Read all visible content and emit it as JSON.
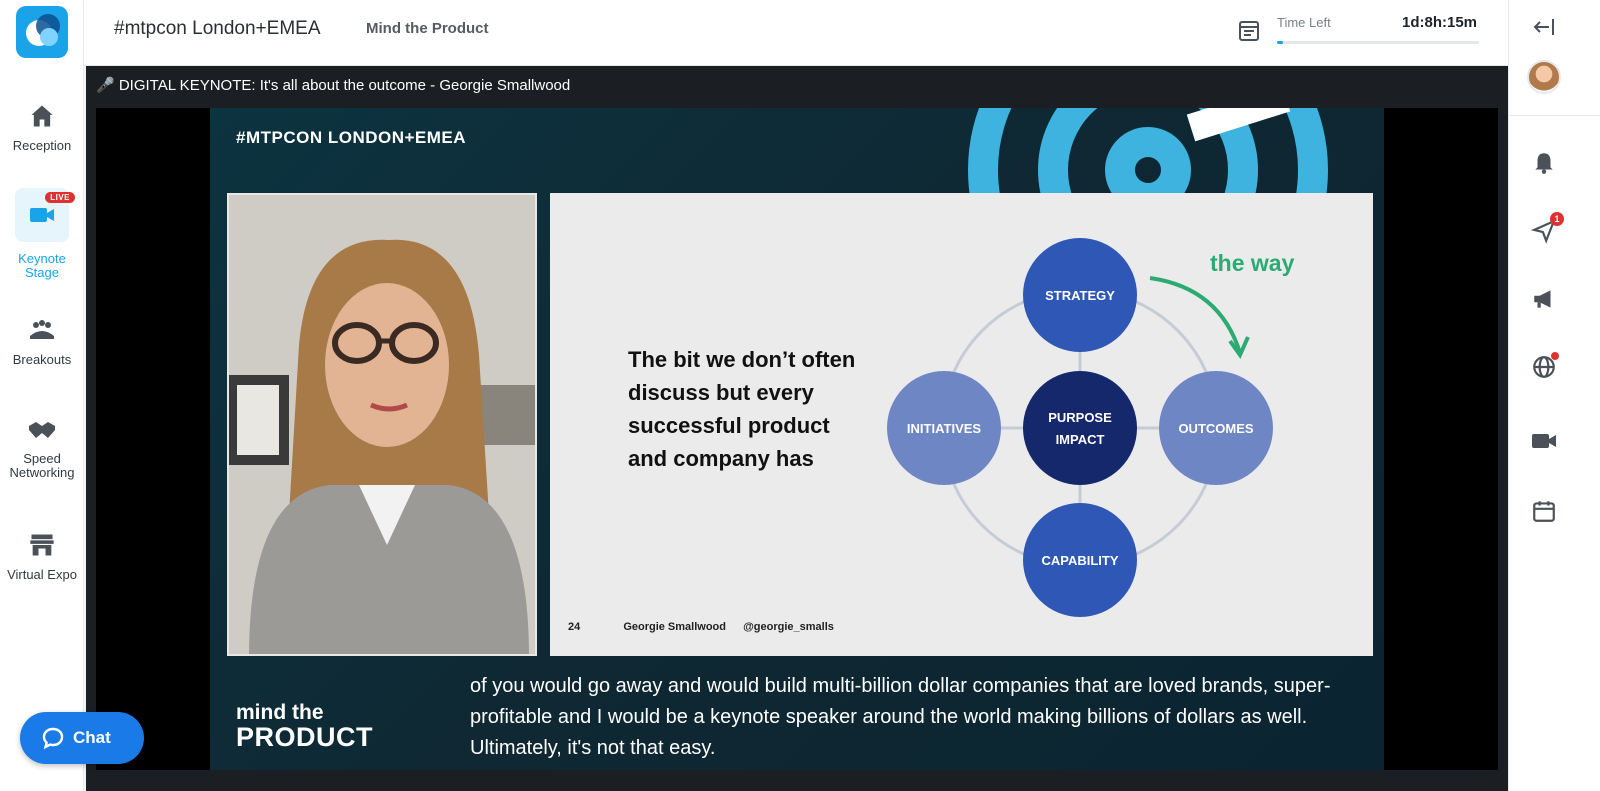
{
  "header": {
    "event_title": "#mtpcon London+EMEA",
    "org_name": "Mind the Product",
    "time_left_label": "Time Left",
    "time_left_value": "1d:8h:15m",
    "time_progress": 0.03
  },
  "nav": {
    "items": [
      {
        "label": "Reception",
        "icon": "home-icon"
      },
      {
        "label": "Keynote Stage",
        "icon": "video-camera-icon",
        "badge": "LIVE",
        "active": true
      },
      {
        "label": "Breakouts",
        "icon": "group-icon"
      },
      {
        "label": "Speed Networking",
        "icon": "handshake-icon"
      },
      {
        "label": "Virtual Expo",
        "icon": "store-icon"
      }
    ],
    "chat_label": "Chat"
  },
  "right_rail": {
    "message_badge": "1"
  },
  "stage": {
    "session_title": "🎤 DIGITAL KEYNOTE: It's all about the outcome - Georgie Smallwood",
    "slide": {
      "tag": "#MTPCON LONDON+EMEA",
      "headline": "The bit we don’t often discuss but every successful product and company has",
      "the_way": "the way",
      "nodes": {
        "top": "STRATEGY",
        "left": "INITIATIVES",
        "center_1": "PURPOSE",
        "center_2": "IMPACT",
        "right": "OUTCOMES",
        "bottom": "CAPABILITY"
      },
      "page_number": "24",
      "speaker": "Georgie Smallwood",
      "handle": "@georgie_smalls",
      "logo_line1": "mind the",
      "logo_line2": "PRODUCT"
    },
    "caption": "of you would go away and would build multi-billion dollar companies that are loved brands, super-profitable and I would be a keynote speaker around the world making billions of dollars as well.  Ultimately, it's not that easy."
  },
  "colors": {
    "accent": "#1aa3e8",
    "live_red": "#e03131",
    "chat_blue": "#1a7be8",
    "node_dark": "#14286b",
    "node_mid": "#2f57b5",
    "node_light": "#6f86c4",
    "the_way_green": "#2bab73"
  }
}
